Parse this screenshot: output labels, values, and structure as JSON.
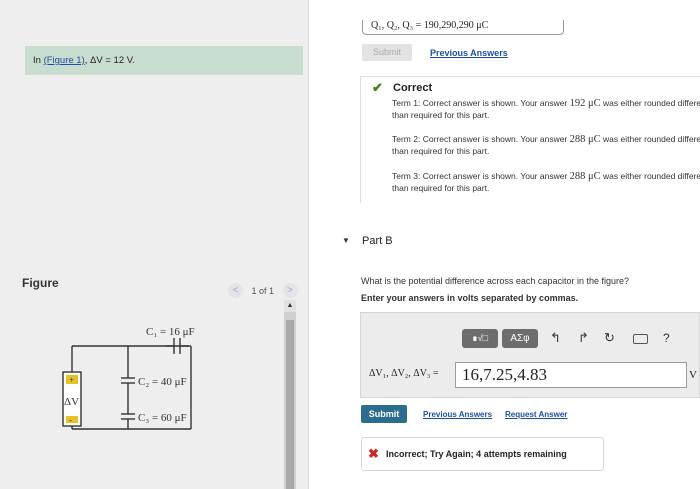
{
  "left": {
    "intro": {
      "prefix": "In ",
      "link": "(Figure 1)",
      "rest": ", ΔV = 12 V."
    },
    "figure_heading": "Figure",
    "pager": {
      "prev": "<",
      "count": "1 of 1",
      "next": ">"
    },
    "circuit": {
      "c1": "C₁ = 16 μF",
      "c2": "C₂ = 40 μF",
      "c3": "C₃ = 60 μF",
      "battery": "ΔV",
      "plus": "+",
      "minus": "-"
    }
  },
  "partA": {
    "answer_strip": "Q₁, Q₂, Q₃ = 190,290,290  μC",
    "submit_label": "Submit",
    "previous_answers_label": "Previous Answers",
    "feedback": {
      "title": "Correct",
      "terms": [
        {
          "line1_pre": "Term 1: Correct answer is shown. Your answer ",
          "value": "192 μC",
          "line1_post": " was either rounded differently or used a different number of significant figures",
          "line2": "than required for this part."
        },
        {
          "line1_pre": "Term 2: Correct answer is shown. Your answer ",
          "value": "288 μC",
          "line1_post": " was either rounded differently or used a different number of significant figures",
          "line2": "than required for this part."
        },
        {
          "line1_pre": "Term 3: Correct answer is shown. Your answer ",
          "value": "288 μC",
          "line1_post": " was either rounded differently or used a different number of significant figures",
          "line2": "than required for this part."
        }
      ]
    }
  },
  "partB": {
    "title": "Part B",
    "question": "What is the potential difference across each capacitor in the figure?",
    "instruction": "Enter your answers in volts separated by commas.",
    "toolbar": {
      "matrix_label": "∎√□",
      "greek_label": "ΑΣφ",
      "undo_icon": "undo-icon",
      "redo_icon": "redo-icon",
      "reset_icon": "reset-icon",
      "keyboard_icon": "keyboard-icon",
      "help_label": "?"
    },
    "variable_label": "ΔV₁, ΔV₂, ΔV₃ =",
    "answer_value": "16,7.25,4.83",
    "unit": "V",
    "submit_label": "Submit",
    "previous_answers_label": "Previous Answers",
    "request_answer_label": "Request Answer",
    "feedback": "Incorrect; Try Again; 4 attempts remaining"
  },
  "colors": {
    "intro_bg": "#c9dcd0",
    "link": "#1f4f9c",
    "submit_bg": "#2b6c8f",
    "correct": "#4a7d1e",
    "incorrect": "#c62b2b"
  }
}
